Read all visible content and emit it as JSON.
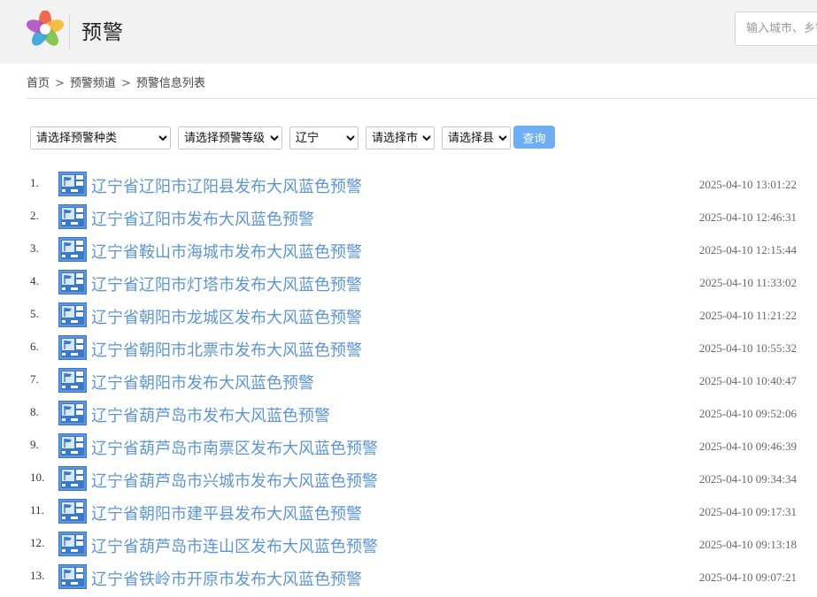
{
  "header": {
    "title": "预警",
    "search_placeholder": "输入城市、乡镇、街道、景点名称"
  },
  "breadcrumb": [
    "首页",
    "预警频道",
    "预警信息列表"
  ],
  "filters": {
    "type": "请选择预警种类",
    "level": "请选择预警等级",
    "province": "辽宁",
    "city": "请选择市",
    "county": "请选择县",
    "query_label": "查询"
  },
  "warnings": [
    {
      "num": "1.",
      "title": "辽宁省辽阳市辽阳县发布大风蓝色预警",
      "time": "2025-04-10 13:01:22",
      "icon": "gale-blue-warning-icon"
    },
    {
      "num": "2.",
      "title": "辽宁省辽阳市发布大风蓝色预警",
      "time": "2025-04-10 12:46:31",
      "icon": "gale-blue-warning-icon"
    },
    {
      "num": "3.",
      "title": "辽宁省鞍山市海城市发布大风蓝色预警",
      "time": "2025-04-10 12:15:44",
      "icon": "gale-blue-warning-icon"
    },
    {
      "num": "4.",
      "title": "辽宁省辽阳市灯塔市发布大风蓝色预警",
      "time": "2025-04-10 11:33:02",
      "icon": "gale-blue-warning-icon"
    },
    {
      "num": "5.",
      "title": "辽宁省朝阳市龙城区发布大风蓝色预警",
      "time": "2025-04-10 11:21:22",
      "icon": "gale-blue-warning-icon"
    },
    {
      "num": "6.",
      "title": "辽宁省朝阳市北票市发布大风蓝色预警",
      "time": "2025-04-10 10:55:32",
      "icon": "gale-blue-warning-icon"
    },
    {
      "num": "7.",
      "title": "辽宁省朝阳市发布大风蓝色预警",
      "time": "2025-04-10 10:40:47",
      "icon": "gale-blue-warning-icon"
    },
    {
      "num": "8.",
      "title": "辽宁省葫芦岛市发布大风蓝色预警",
      "time": "2025-04-10 09:52:06",
      "icon": "gale-blue-warning-icon"
    },
    {
      "num": "9.",
      "title": "辽宁省葫芦岛市南票区发布大风蓝色预警",
      "time": "2025-04-10 09:46:39",
      "icon": "gale-blue-warning-icon"
    },
    {
      "num": "10.",
      "title": "辽宁省葫芦岛市兴城市发布大风蓝色预警",
      "time": "2025-04-10 09:34:34",
      "icon": "gale-blue-warning-icon"
    },
    {
      "num": "11.",
      "title": "辽宁省朝阳市建平县发布大风蓝色预警",
      "time": "2025-04-10 09:17:31",
      "icon": "gale-blue-warning-icon"
    },
    {
      "num": "12.",
      "title": "辽宁省葫芦岛市连山区发布大风蓝色预警",
      "time": "2025-04-10 09:13:18",
      "icon": "gale-blue-warning-icon"
    },
    {
      "num": "13.",
      "title": "辽宁省铁岭市开原市发布大风蓝色预警",
      "time": "2025-04-10 09:07:21",
      "icon": "gale-blue-warning-icon"
    }
  ],
  "colors": {
    "link": "#5c95d6",
    "button": "#6eaef5",
    "warning_blue": "#3a78c9"
  }
}
